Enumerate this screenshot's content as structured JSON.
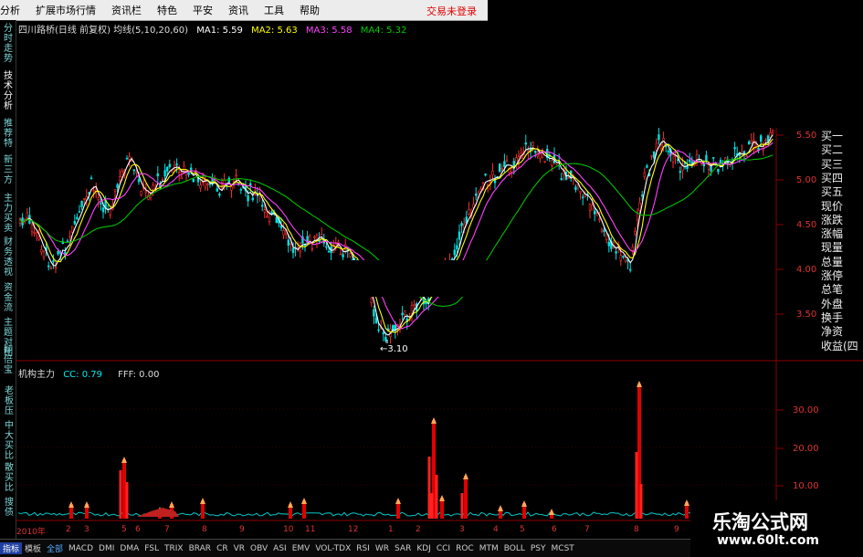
{
  "menu": {
    "items": [
      "分析",
      "扩展市场行情",
      "资讯栏",
      "特色",
      "平安",
      "资讯",
      "工具",
      "帮助"
    ],
    "alert": "交易未登录"
  },
  "sidebar": {
    "items": [
      "分时走势",
      "技术分析",
      "推荐特",
      "新三方",
      "主力买卖",
      "财务透视",
      "资金流",
      "主题对比",
      "翻倍宝"
    ]
  },
  "main_chart": {
    "title": "四川路桥(日线 前复权) 均线(5,10,20,60)",
    "ma1": "MA1: 5.59",
    "ma2": "MA2: 5.63",
    "ma3": "MA3: 5.58",
    "ma4": "MA4: 5.32",
    "low_label": "←3.10",
    "y_ticks": [
      "5.50",
      "5.00",
      "4.50",
      "4.00",
      "3.50"
    ]
  },
  "indicator": {
    "title": "机构主力",
    "cc": "CC: 0.79",
    "fff": "FFF: 0.00",
    "y_ticks": [
      "30.00",
      "20.00",
      "10.00"
    ],
    "side_labels": [
      "老板压",
      "中大买比",
      "散买比",
      "搜债"
    ]
  },
  "right_panel": {
    "items": [
      "买一",
      "买二",
      "买三",
      "买四",
      "买五",
      "现价",
      "涨跌",
      "涨幅",
      "现量",
      "总量",
      "涨停",
      "总笔",
      "外盘",
      "换手",
      "净资",
      "收益(四"
    ]
  },
  "x_labels": [
    "2010年",
    "2",
    "3",
    "5",
    "6",
    "7",
    "8",
    "9",
    "10",
    "11",
    "12",
    "1",
    "2",
    "3",
    "4",
    "5",
    "6",
    "7",
    "8",
    "9"
  ],
  "bottom_tabs": [
    "指标",
    "模板",
    "全部",
    "MACD",
    "DMI",
    "DMA",
    "FSL",
    "TRIX",
    "BRAR",
    "CR",
    "VR",
    "OBV",
    "ASI",
    "EMV",
    "VOL-TDX",
    "RSI",
    "WR",
    "SAR",
    "KDJ",
    "CCI",
    "ROC",
    "MTM",
    "BOLL",
    "PSY",
    "MCST"
  ],
  "watermark": {
    "line1": "乐淘公式网",
    "line2": "www.60lt.com"
  },
  "colors": {
    "up": "#ff3030",
    "down": "#00e0e0",
    "ma1": "#ffffff",
    "ma2": "#ffff00",
    "ma3": "#ff40ff",
    "ma4": "#00c000",
    "grid": "#8b0000"
  }
}
